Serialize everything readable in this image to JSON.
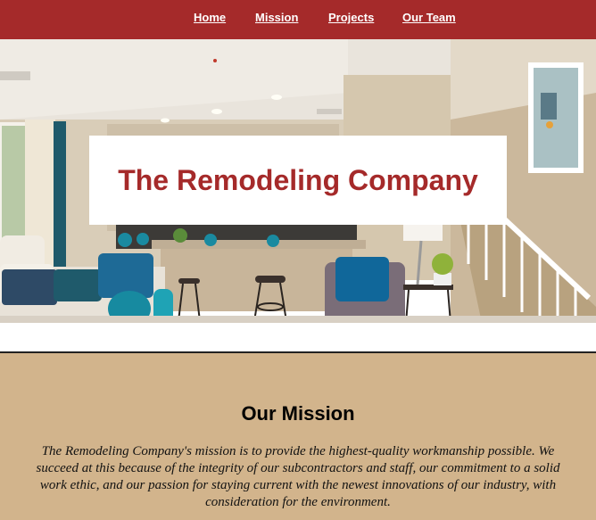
{
  "nav": {
    "items": [
      {
        "label": "Home"
      },
      {
        "label": "Mission"
      },
      {
        "label": "Projects"
      },
      {
        "label": "Our Team"
      }
    ]
  },
  "hero": {
    "title": "The Remodeling Company"
  },
  "mission": {
    "heading": "Our Mission",
    "body": "The Remodeling Company's mission is to provide the highest-quality workmanship possible. We succeed at this because of the integrity of our subcontractors and staff, our commitment to a solid work ethic, and our passion for staying current with the newest innovations of our industry, with consideration for the environment."
  },
  "colors": {
    "nav_background": "#a52a2a",
    "title_color": "#a52a2a",
    "mission_background": "#d2b48c"
  }
}
